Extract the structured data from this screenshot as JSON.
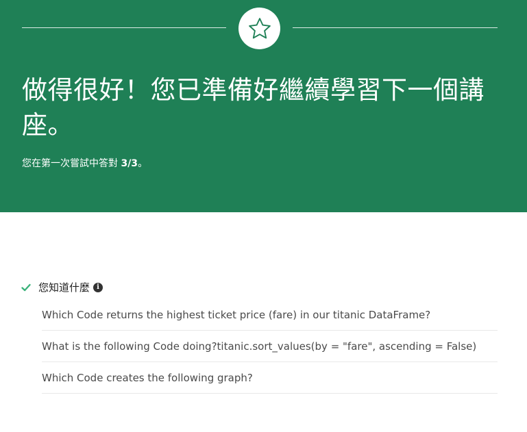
{
  "banner": {
    "background_color": "#1f8056",
    "star_icon": "star-outline-icon",
    "headline": "做得很好！您已準備好繼續學習下一個講座。",
    "subline_prefix": "您在第一次嘗試中答對 ",
    "score": "3/3",
    "subline_suffix": "。"
  },
  "results": {
    "check_icon": "check-icon",
    "check_color": "#3ab27a",
    "section_title": "您知道什麼",
    "info_icon": "info-icon",
    "info_glyph": "i",
    "questions": [
      "Which Code returns the highest ticket price (fare) in our titanic DataFrame?",
      "What is the following Code doing?titanic.sort_values(by = \"fare\", ascending = False)",
      "Which Code creates the following graph?"
    ]
  }
}
